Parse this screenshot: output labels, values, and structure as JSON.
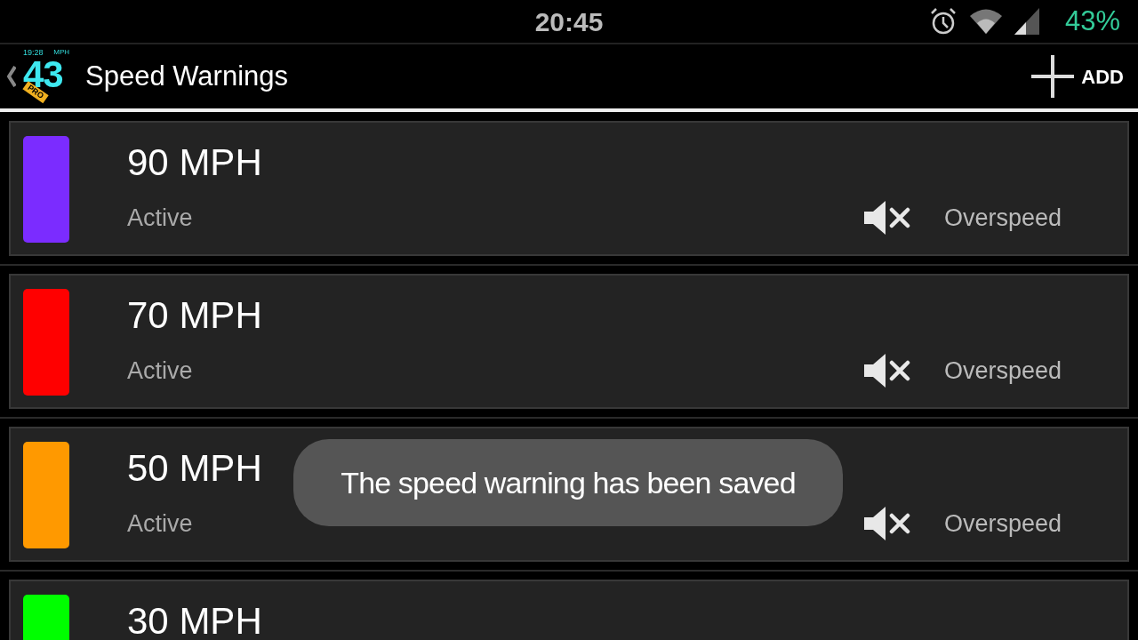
{
  "status_bar": {
    "time": "20:45",
    "battery": "43%"
  },
  "action_bar": {
    "logo": {
      "clock": "19:28",
      "unit": "MPH",
      "speed": "43",
      "badge": "PRO"
    },
    "title": "Speed Warnings",
    "add_label": "ADD"
  },
  "warnings": [
    {
      "speed": "90 MPH",
      "color": "#7b2cff",
      "status": "Active",
      "muted": true,
      "type": "Overspeed"
    },
    {
      "speed": "70 MPH",
      "color": "#ff0000",
      "status": "Active",
      "muted": true,
      "type": "Overspeed"
    },
    {
      "speed": "50 MPH",
      "color": "#ff9900",
      "status": "Active",
      "muted": true,
      "type": "Overspeed"
    },
    {
      "speed": "30 MPH",
      "color": "#00ff00"
    }
  ],
  "toast": "The speed warning has been saved"
}
